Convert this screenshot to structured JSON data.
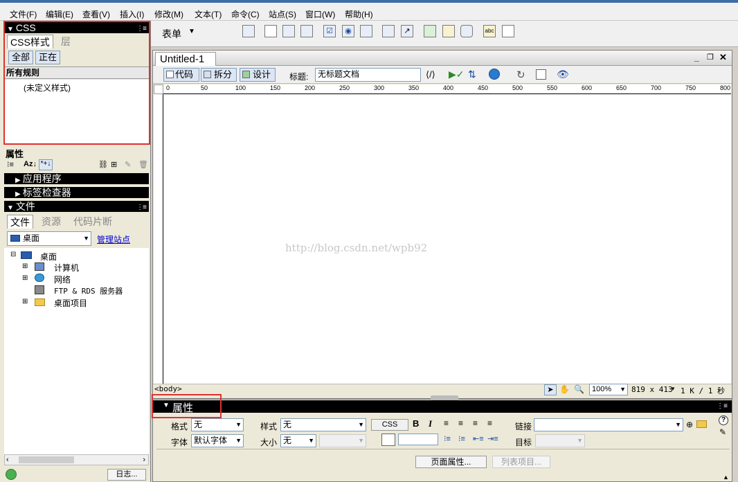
{
  "menubar": {
    "items": [
      "文件(F)",
      "编辑(E)",
      "查看(V)",
      "插入(I)",
      "修改(M)",
      "文本(T)",
      "命令(C)",
      "站点(S)",
      "窗口(W)",
      "帮助(H)"
    ]
  },
  "css_panel": {
    "header": "CSS",
    "tabs": [
      "CSS样式",
      "层"
    ],
    "buttons": [
      "全部",
      "正在"
    ],
    "section_title": "所有规则",
    "rule": "(未定义样式)"
  },
  "properties_panel": {
    "title": "属性"
  },
  "collapsed_panels": [
    "应用程序",
    "标签检查器"
  ],
  "files_panel": {
    "header": "文件",
    "tabs": [
      "文件",
      "资源",
      "代码片断"
    ],
    "location": "桌面",
    "manage_link": "管理站点",
    "tree": [
      "桌面",
      "计算机",
      "网络",
      "FTP & RDS 服务器",
      "桌面项目"
    ],
    "log_button": "日志..."
  },
  "insert_toolbar": {
    "category": "表单"
  },
  "document": {
    "tab_title": "Untitled-1",
    "view_buttons": [
      "代码",
      "拆分",
      "设计"
    ],
    "title_label": "标题:",
    "title_value": "无标题文档",
    "ruler_ticks": [
      "0",
      "50",
      "100",
      "150",
      "200",
      "250",
      "300",
      "350",
      "400",
      "450",
      "500",
      "550",
      "600",
      "650",
      "700",
      "750",
      "800"
    ],
    "watermark": "http://blog.csdn.net/wpb92",
    "status": {
      "tag": "<body>",
      "zoom": "100%",
      "size": "819 x 413",
      "weight": "1 K / 1 秒"
    }
  },
  "property_inspector": {
    "title": "属性",
    "format_label": "格式",
    "format_value": "无",
    "font_label": "字体",
    "font_value": "默认字体",
    "style_label": "样式",
    "style_value": "无",
    "size_label": "大小",
    "size_value": "无",
    "css_button": "CSS",
    "link_label": "链接",
    "target_label": "目标",
    "page_props_button": "页面属性...",
    "list_item_button": "列表项目..."
  }
}
